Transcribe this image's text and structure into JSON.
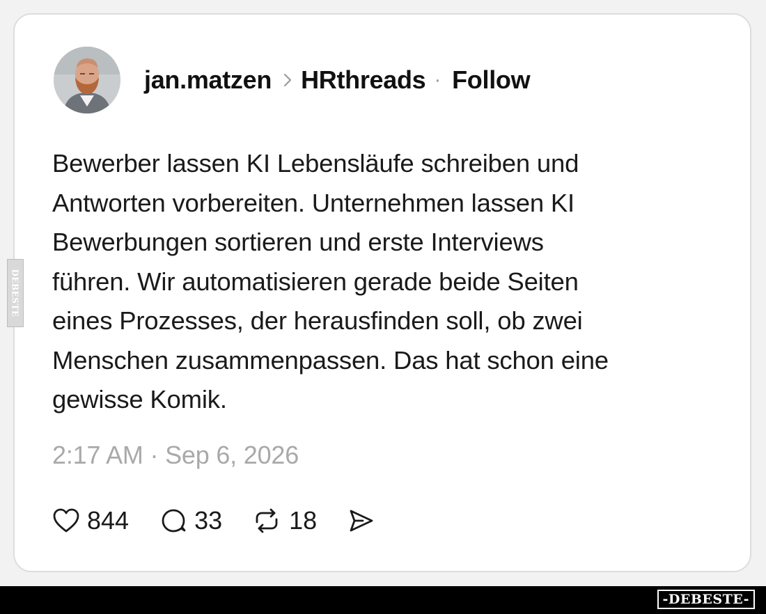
{
  "post": {
    "author": {
      "username": "jan.matzen",
      "community": "HRthreads",
      "separator": "·",
      "follow_label": "Follow"
    },
    "text": "Bewerber lassen KI Lebensläufe schreiben und Antworten vorbereiten. Unternehmen lassen KI Bewerbungen sortieren und erste Interviews führen. Wir automatisieren gerade beide Seiten eines Prozesses, der herausfinden soll, ob zwei Menschen zusammenpassen. Das hat schon eine gewisse Komik.",
    "text_lines": [
      "Bewerber lassen KI Lebensläufe schreiben und",
      "Antworten vorbereiten. Unternehmen lassen KI",
      "Bewerbungen sortieren und erste Interviews",
      "führen. Wir automatisieren gerade beide Seiten",
      "eines Prozesses, der herausfinden soll, ob zwei",
      "Menschen zusammenpassen. Das hat schon eine",
      "gewisse Komik."
    ],
    "timestamp": "2:17 AM · Sep 6, 2026",
    "actions": {
      "likes": "844",
      "replies": "33",
      "reposts": "18"
    },
    "icons": [
      "heart-icon",
      "reply-bubble-icon",
      "repost-icon",
      "share-icon",
      "chevron-right-icon"
    ]
  },
  "watermark": {
    "side_text": "DEBESTE",
    "bottom_text": "-DEBESTE-"
  },
  "colors": {
    "text": "#111111",
    "muted": "#a9a9a9",
    "card_background": "#ffffff",
    "page_background": "#f2f2f2",
    "bar_background": "#000000"
  }
}
